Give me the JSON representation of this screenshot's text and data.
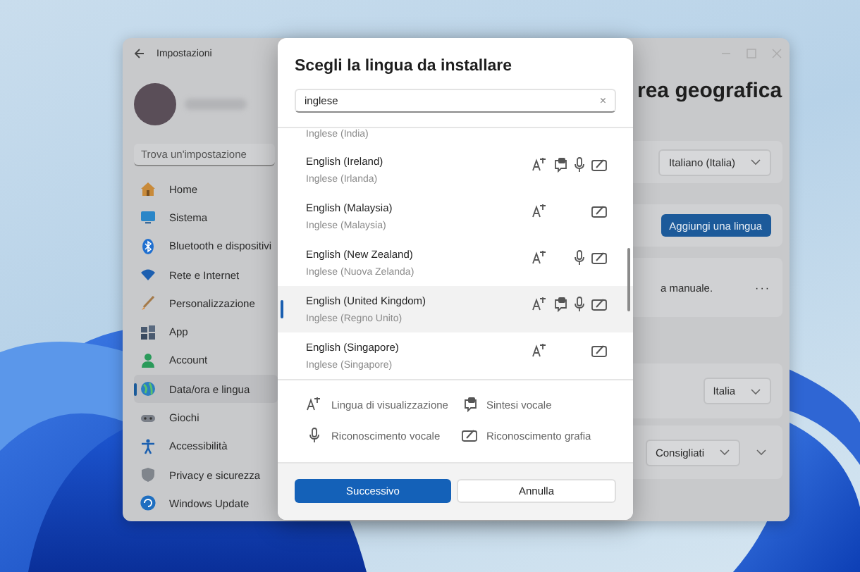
{
  "settings": {
    "title": "Impostazioni",
    "search": {
      "placeholder": "Trova un'impostazione"
    },
    "sidebar": {
      "items": [
        {
          "label": "Home",
          "selected": false
        },
        {
          "label": "Sistema",
          "selected": false
        },
        {
          "label": "Bluetooth e dispositivi",
          "selected": false
        },
        {
          "label": "Rete e Internet",
          "selected": false
        },
        {
          "label": "Personalizzazione",
          "selected": false
        },
        {
          "label": "App",
          "selected": false
        },
        {
          "label": "Account",
          "selected": false
        },
        {
          "label": "Data/ora e lingua",
          "selected": true
        },
        {
          "label": "Giochi",
          "selected": false
        },
        {
          "label": "Accessibilità",
          "selected": false
        },
        {
          "label": "Privacy e sicurezza",
          "selected": false
        },
        {
          "label": "Windows Update",
          "selected": false
        }
      ]
    },
    "page_title": "rea geografica",
    "cards": [
      {
        "kind": "dropdown",
        "value": "Italiano (Italia)"
      },
      {
        "kind": "button",
        "label": "Aggiungi una lingua"
      },
      {
        "kind": "more",
        "text": "a manuale.",
        "more": "···"
      },
      {
        "kind": "dropdown",
        "value": "Italia"
      },
      {
        "kind": "dropdown_expand",
        "value": "Consigliati"
      }
    ]
  },
  "dialog": {
    "title": "Scegli la lingua da installare",
    "search": {
      "value": "inglese",
      "clear": "×"
    },
    "languages": [
      {
        "localized": "Inglese (India)",
        "selected": false
      },
      {
        "name": "English (Ireland)",
        "localized": "Inglese (Irlanda)",
        "selected": false,
        "features": {
          "display": true,
          "tts": true,
          "speech": true,
          "handwriting": true
        }
      },
      {
        "name": "English (Malaysia)",
        "localized": "Inglese (Malaysia)",
        "selected": false,
        "features": {
          "display": true,
          "tts": false,
          "speech": false,
          "handwriting": true
        }
      },
      {
        "name": "English (New Zealand)",
        "localized": "Inglese (Nuova Zelanda)",
        "selected": false,
        "features": {
          "display": true,
          "tts": false,
          "speech": true,
          "handwriting": true
        }
      },
      {
        "name": "English (United Kingdom)",
        "localized": "Inglese (Regno Unito)",
        "selected": true,
        "features": {
          "display": true,
          "tts": true,
          "speech": true,
          "handwriting": true
        }
      },
      {
        "name": "English (Singapore)",
        "localized": "Inglese (Singapore)",
        "selected": false,
        "features": {
          "display": true,
          "tts": false,
          "speech": false,
          "handwriting": true
        }
      }
    ],
    "legend": [
      {
        "kind": "display",
        "label": "Lingua di visualizzazione"
      },
      {
        "kind": "tts",
        "label": "Sintesi vocale"
      },
      {
        "kind": "speech",
        "label": "Riconoscimento vocale"
      },
      {
        "kind": "handwriting",
        "label": "Riconoscimento grafia"
      }
    ],
    "buttons": [
      {
        "kind": "primary",
        "label": "Successivo"
      },
      {
        "kind": "secondary",
        "label": "Annulla"
      }
    ]
  }
}
